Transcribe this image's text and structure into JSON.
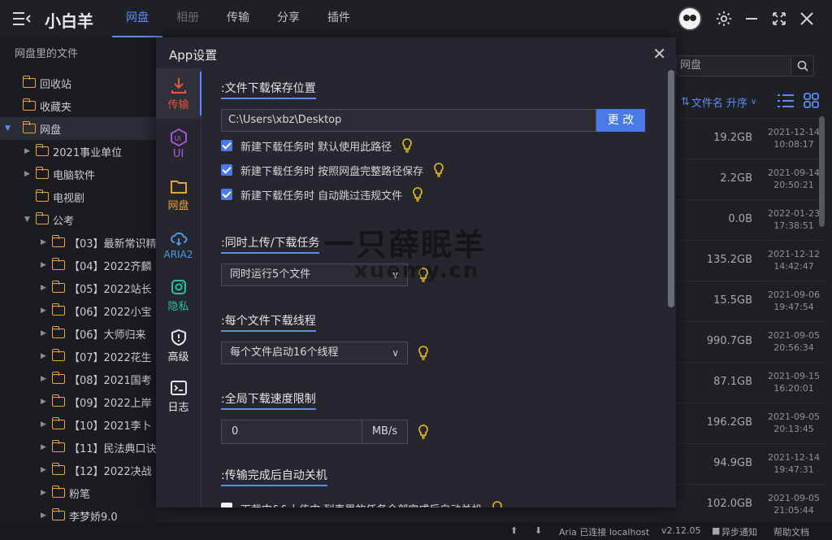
{
  "app": {
    "name": "小白羊"
  },
  "tabs": [
    "网盘",
    "相册",
    "传输",
    "分享",
    "插件"
  ],
  "sidebar": {
    "header": "网盘里的文件",
    "items": [
      {
        "label": "回收站",
        "icon": "recycle-icon"
      },
      {
        "label": "收藏夹",
        "icon": "favorite-folder-icon"
      },
      {
        "label": "网盘",
        "icon": "folder-icon"
      },
      {
        "label": "2021事业单位"
      },
      {
        "label": "电脑软件"
      },
      {
        "label": "电视剧"
      },
      {
        "label": "公考"
      },
      {
        "label": "【03】最新常识精"
      },
      {
        "label": "【04】2022齐麟"
      },
      {
        "label": "【05】2022站长"
      },
      {
        "label": "【06】2022小宝"
      },
      {
        "label": "【06】大师归来"
      },
      {
        "label": "【07】2022花生"
      },
      {
        "label": "【08】2021国考"
      },
      {
        "label": "【09】2022上岸"
      },
      {
        "label": "【10】2021李卜"
      },
      {
        "label": "【11】民法典口诀"
      },
      {
        "label": "【12】2022决战"
      },
      {
        "label": "粉笔"
      },
      {
        "label": "李梦娇9.0"
      }
    ]
  },
  "right_panel": {
    "search_placeholder": "网盘",
    "sort_label": "文件名 升序",
    "files": [
      {
        "size": "19.2GB",
        "date": "2021-12-14",
        "time": "10:08:17"
      },
      {
        "size": "2.2GB",
        "date": "2021-09-14",
        "time": "20:50:21"
      },
      {
        "size": "0.0B",
        "date": "2022-01-23",
        "time": "17:38:51"
      },
      {
        "size": "135.2GB",
        "date": "2021-12-12",
        "time": "14:42:47"
      },
      {
        "size": "15.5GB",
        "date": "2021-09-06",
        "time": "19:47:54"
      },
      {
        "size": "990.7GB",
        "date": "2021-09-05",
        "time": "20:56:34"
      },
      {
        "size": "87.1GB",
        "date": "2021-09-15",
        "time": "16:20:01"
      },
      {
        "size": "196.2GB",
        "date": "2021-09-05",
        "time": "20:13:45"
      },
      {
        "size": "94.9GB",
        "date": "2021-12-14",
        "time": "19:47:31"
      },
      {
        "size": "102.0GB",
        "date": "2021-09-05",
        "time": "21:05:44"
      }
    ]
  },
  "modal": {
    "title": "App设置",
    "nav": [
      {
        "label": "传输",
        "color": "#e8553a"
      },
      {
        "label": "UI",
        "color": "#b25ae8"
      },
      {
        "label": "网盘",
        "color": "#e8a33a"
      },
      {
        "label": "ARIA2",
        "color": "#4a9ae8"
      },
      {
        "label": "隐私",
        "color": "#27c2a0"
      },
      {
        "label": "高级",
        "color": "#e6e7ec"
      },
      {
        "label": "日志",
        "color": "#e6e7ec"
      }
    ],
    "sections": {
      "save_path": {
        "title": ":文件下载保存位置",
        "value": "C:\\Users\\xbz\\Desktop",
        "button": "更 改",
        "options": [
          "新建下载任务时 默认使用此路径",
          "新建下载任务时 按照网盘完整路径保存",
          "新建下载任务时 自动跳过违规文件"
        ]
      },
      "concurrent": {
        "title": ":同时上传/下载任务",
        "selected": "同时运行5个文件"
      },
      "threads": {
        "title": ":每个文件下载线程",
        "selected": "每个文件启动16个线程"
      },
      "speed": {
        "title": ":全局下载速度限制",
        "value": "0",
        "unit": "MB/s"
      },
      "shutdown": {
        "title": ":传输完成后自动关机",
        "option": "下载中&&上传中 列表里的任务全部完成后自动关机"
      }
    }
  },
  "watermark": {
    "line1": "一只薛眠羊",
    "line2": "xuemy.cn"
  },
  "status_bar": {
    "aria": "Aria 已连接 localhost",
    "version": "v2.12.05",
    "async": "异步通知",
    "help": "帮助文档"
  },
  "colors": {
    "accent": "#5b8cf5",
    "folder": "#e8a33a",
    "bulb": "#f2c21a"
  }
}
